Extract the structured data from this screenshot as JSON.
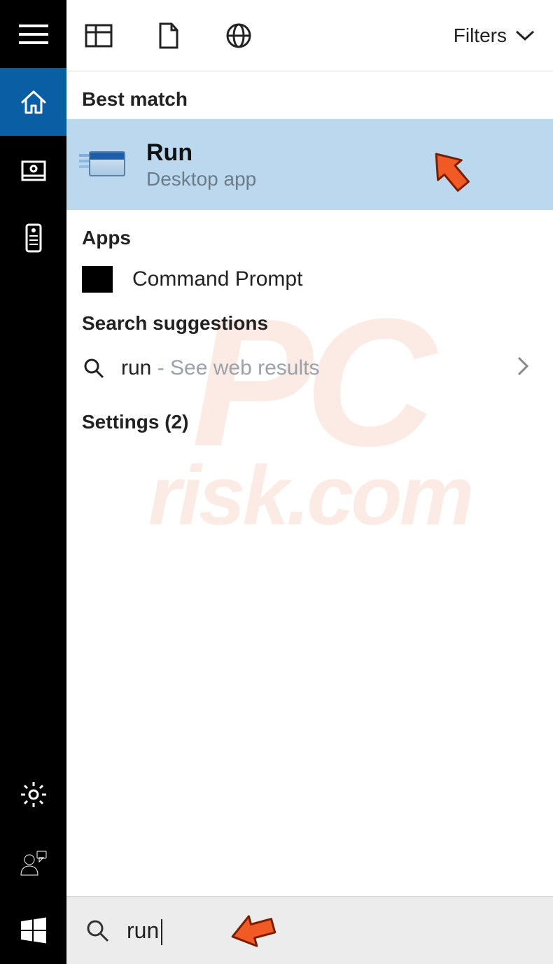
{
  "toolbar": {
    "filters_label": "Filters"
  },
  "sections": {
    "best_match_label": "Best match",
    "apps_label": "Apps",
    "suggestions_label": "Search suggestions"
  },
  "best_match": {
    "title": "Run",
    "subtitle": "Desktop app"
  },
  "apps": [
    {
      "label": "Command Prompt"
    }
  ],
  "suggestions": [
    {
      "term": "run",
      "hint": " - See web results"
    }
  ],
  "settings": {
    "label": "Settings (2)"
  },
  "search": {
    "value": "run"
  },
  "watermark": {
    "line1": "PC",
    "line2": "risk.com"
  }
}
